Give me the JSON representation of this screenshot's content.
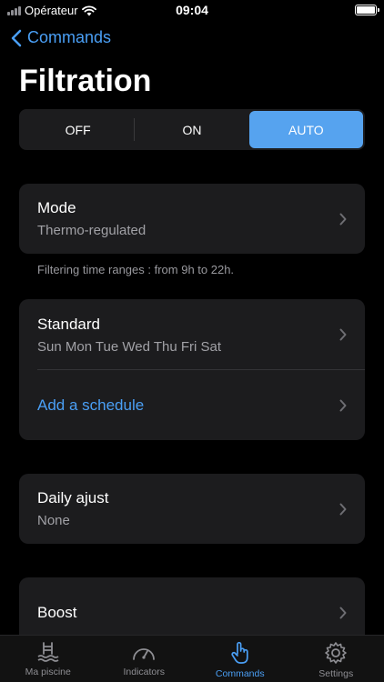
{
  "status_bar": {
    "carrier": "Opérateur",
    "time": "09:04"
  },
  "nav": {
    "back_label": "Commands"
  },
  "page": {
    "title": "Filtration"
  },
  "segmented": {
    "options": [
      "OFF",
      "ON",
      "AUTO"
    ],
    "selected": "AUTO",
    "active_color": "#56a3ef"
  },
  "mode": {
    "title": "Mode",
    "value": "Thermo-regulated"
  },
  "footnote": "Filtering time ranges : from 9h to 22h.",
  "schedule": {
    "title": "Standard",
    "days": "Sun Mon Tue Wed Thu Fri Sat",
    "add_label": "Add a schedule"
  },
  "daily_adjust": {
    "title": "Daily ajust",
    "value": "None"
  },
  "boost": {
    "title": "Boost"
  },
  "tabs": [
    {
      "label": "Ma piscine",
      "icon": "pool-icon",
      "active": false
    },
    {
      "label": "Indicators",
      "icon": "gauge-icon",
      "active": false
    },
    {
      "label": "Commands",
      "icon": "hand-pointer-icon",
      "active": true
    },
    {
      "label": "Settings",
      "icon": "gear-icon",
      "active": false
    }
  ],
  "colors": {
    "accent": "#4a9ff5",
    "background": "#000000",
    "card": "#1c1c1e"
  }
}
